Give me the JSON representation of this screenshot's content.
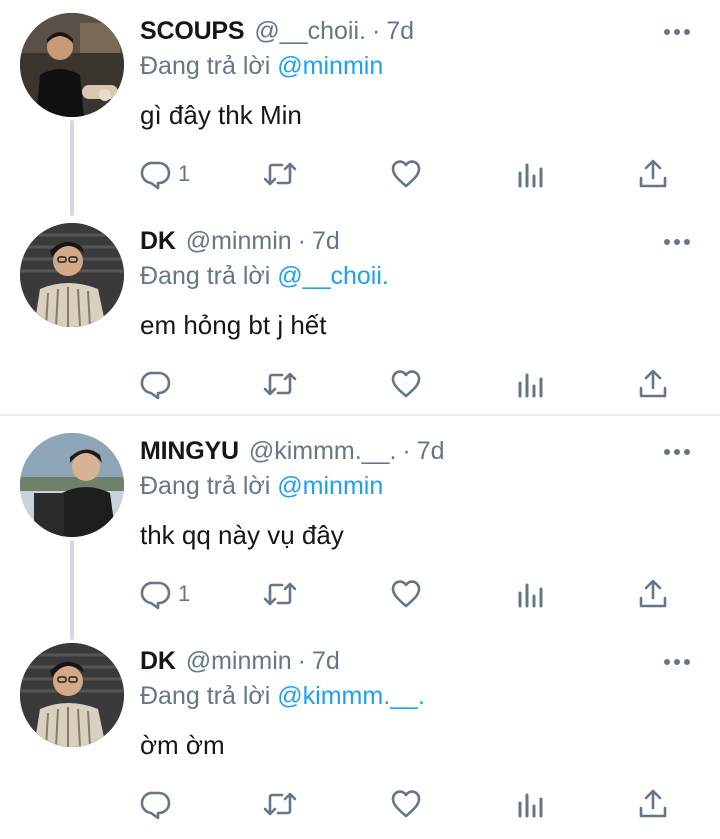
{
  "replying_label": "Đang trả lời",
  "colors": {
    "text": "#14171a",
    "muted": "#657786",
    "mention": "#1da1f2",
    "thread_line": "#cfd9de",
    "divider": "#e6ecf0"
  },
  "icons": {
    "reply": "reply-icon",
    "retweet": "retweet-icon",
    "like": "heart-icon",
    "stats": "analytics-icon",
    "share": "share-icon",
    "more": "more-icon"
  },
  "tweets": [
    {
      "name": "SCOUPS",
      "handle": "@__choii.",
      "separator": "·",
      "time": "7d",
      "reply_to": "@minmin",
      "text": "gì đây thk Min",
      "reply_count": "1"
    },
    {
      "name": "DK",
      "handle": "@minmin",
      "separator": "·",
      "time": "7d",
      "reply_to": "@__choii.",
      "text": "em hỏng bt j hết",
      "reply_count": ""
    },
    {
      "name": "MINGYU",
      "handle": "@kimmm.__.",
      "separator": "·",
      "time": "7d",
      "reply_to": "@minmin",
      "text": "thk qq này vụ đây",
      "reply_count": "1"
    },
    {
      "name": "DK",
      "handle": "@minmin",
      "separator": "·",
      "time": "7d",
      "reply_to": "@kimmm.__.",
      "text": "ờm ờm",
      "reply_count": ""
    }
  ]
}
